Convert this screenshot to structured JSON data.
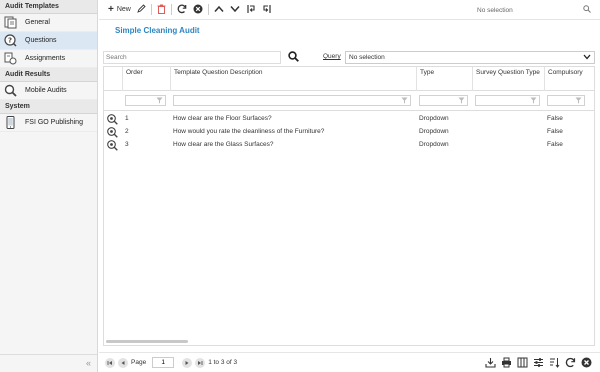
{
  "sidebar": {
    "sections": [
      {
        "header": "Audit Templates",
        "items": [
          {
            "label": "General",
            "icon": "document-icon",
            "active": false
          },
          {
            "label": "Questions",
            "icon": "question-icon",
            "active": true
          },
          {
            "label": "Assignments",
            "icon": "assignment-icon",
            "active": false
          }
        ]
      },
      {
        "header": "Audit Results",
        "items": [
          {
            "label": "Mobile Audits",
            "icon": "magnifier-icon",
            "active": false
          }
        ]
      },
      {
        "header": "System",
        "items": [
          {
            "label": "FSI GO Publishing",
            "icon": "mobile-icon",
            "active": false
          }
        ]
      }
    ],
    "collapse_glyph": "«"
  },
  "toolbar": {
    "new_label": "New",
    "search_value": "No selection"
  },
  "title": "Simple Cleaning Audit",
  "search": {
    "placeholder": "Search"
  },
  "query": {
    "label": "Query",
    "selected": "No selection"
  },
  "grid": {
    "columns": [
      "Order",
      "Template Question Description",
      "Type",
      "Survey Question Type",
      "Compulsory"
    ],
    "rows": [
      {
        "order": "1",
        "description": "How clear are the Floor Surfaces?",
        "type": "Dropdown",
        "survey_type": "",
        "compulsory": "False"
      },
      {
        "order": "2",
        "description": "How would you rate the cleanliness of the Furniture?",
        "type": "Dropdown",
        "survey_type": "",
        "compulsory": "False"
      },
      {
        "order": "3",
        "description": "How clear are the Glass Surfaces?",
        "type": "Dropdown",
        "survey_type": "",
        "compulsory": "False"
      }
    ]
  },
  "pager": {
    "page_label": "Page",
    "page_value": "1",
    "range_text": "1 to 3 of 3"
  },
  "colors": {
    "accent": "#2e86c1",
    "active_bg": "#dbe7f3",
    "delete": "#e05a5a"
  }
}
